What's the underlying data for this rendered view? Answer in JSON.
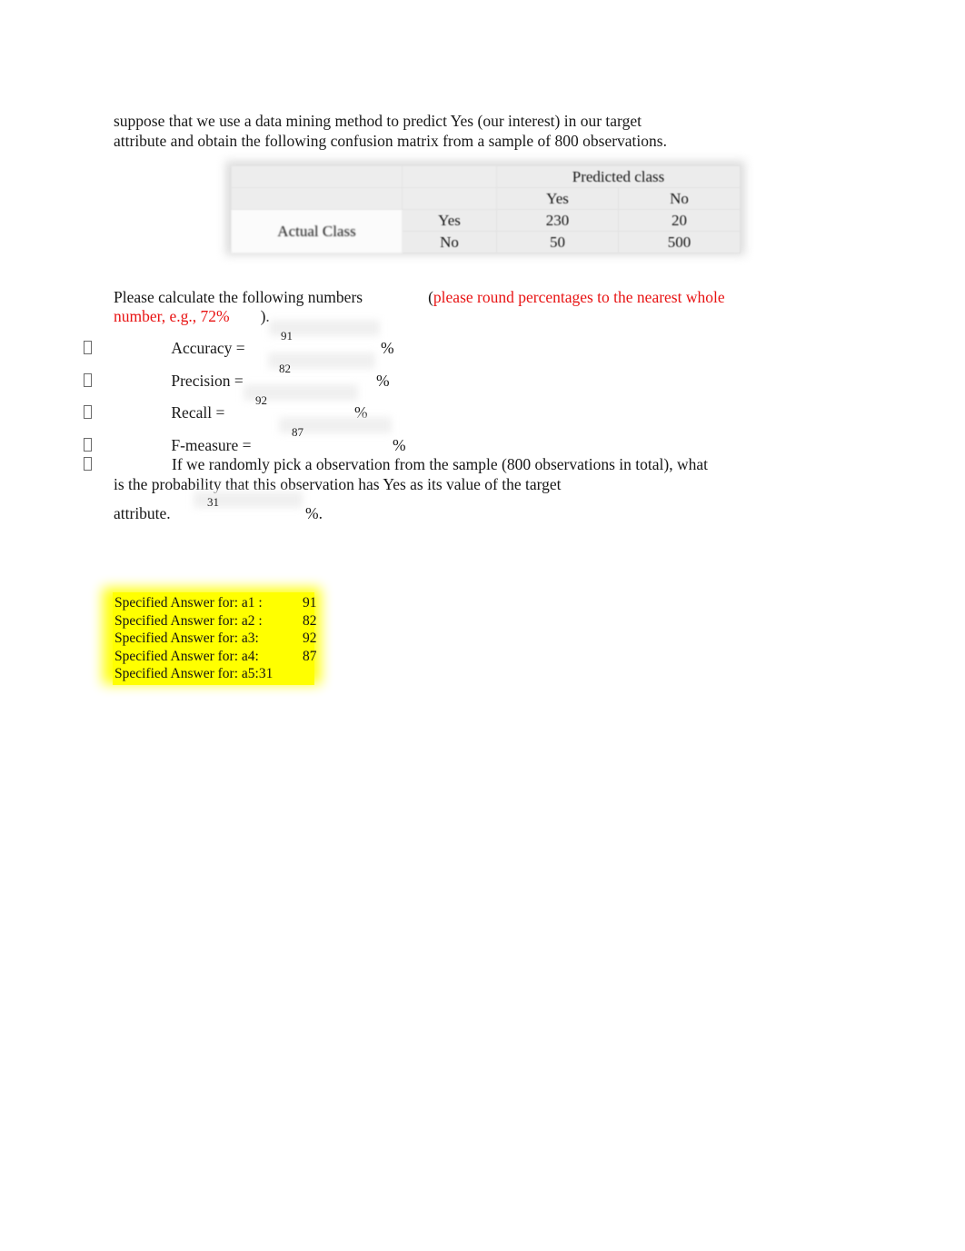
{
  "intro": {
    "line1": "suppose that we use a data mining method to predict Yes (our interest) in our target",
    "line2": "attribute and obtain the following confusion matrix from a sample of 800 observations."
  },
  "confusion_matrix": {
    "predicted_header": "Predicted class",
    "actual_header": "Actual Class",
    "column_labels": [
      "Yes",
      "No"
    ],
    "row_labels": [
      "Yes",
      "No"
    ],
    "cells": [
      [
        "230",
        "20"
      ],
      [
        "50",
        "500"
      ]
    ]
  },
  "instruction": {
    "black_lead": "Please calculate the following numbers",
    "paren_open": "(",
    "red_part1": "please round percentages to the nearest whole",
    "red_part2": "number, e.g., 72%",
    "paren_close": ").",
    "note_color": "#e81313"
  },
  "questions": [
    {
      "bullet": "□",
      "label": "Accuracy =",
      "value": "91",
      "unit": "%"
    },
    {
      "bullet": "□",
      "label": "Precision =",
      "value": "82",
      "unit": "%"
    },
    {
      "bullet": "□",
      "label": "Recall =",
      "value": "92",
      "unit": "%"
    },
    {
      "bullet": "□",
      "label": "F-measure =",
      "value": "87",
      "unit": "%"
    }
  ],
  "last_question": {
    "bullet": "□",
    "line1": "If we randomly pick a observation from the sample (800 observations in total), what",
    "line2": "is the probability that this observation has Yes as its value of the target",
    "line3_label": "attribute.",
    "value": "31",
    "unit": "%."
  },
  "answer_key": {
    "highlight_color": "#ffff00",
    "rows": [
      {
        "label": "Specified Answer for: a1 :",
        "value": "91"
      },
      {
        "label": "Specified Answer for: a2 :",
        "value": "82"
      },
      {
        "label": "Specified Answer for: a3:",
        "value": "92"
      },
      {
        "label": "Specified Answer for: a4:",
        "value": "87"
      },
      {
        "label": "Specified Answer for: a5:31",
        "value": ""
      }
    ]
  }
}
